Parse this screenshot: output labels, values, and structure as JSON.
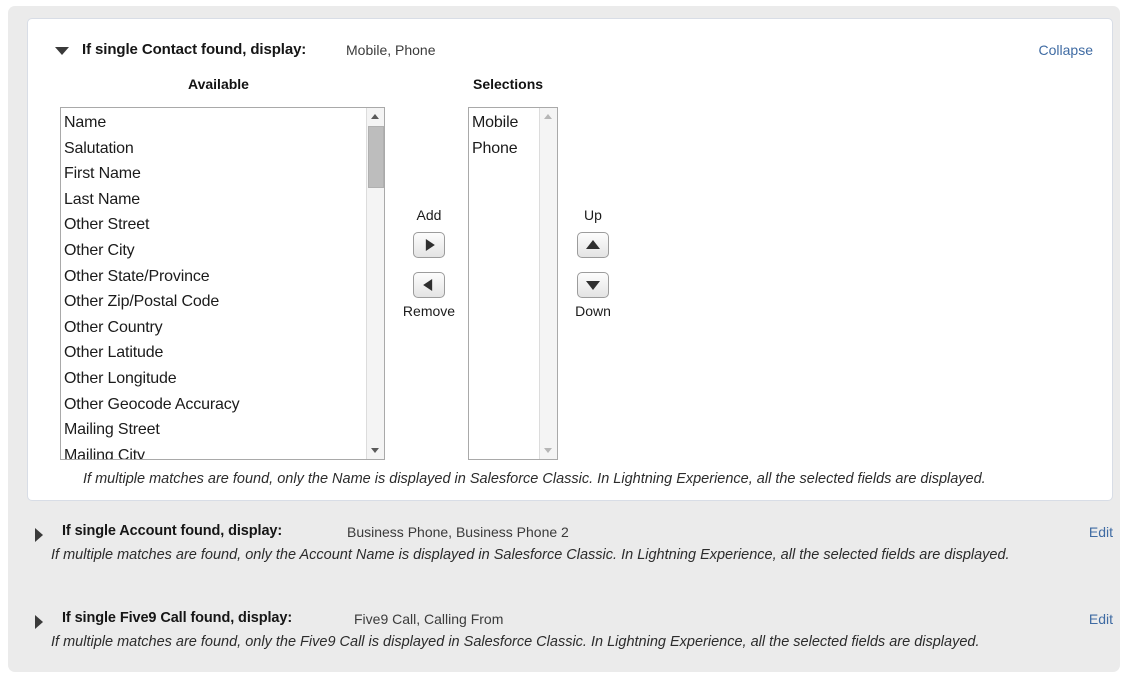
{
  "expanded_section": {
    "toggle_icon": "caret-down-icon",
    "label": "If single Contact found, display:",
    "value": "Mobile, Phone",
    "collapse_label": "Collapse",
    "available_title": "Available",
    "selections_title": "Selections",
    "available_options": [
      "Name",
      "Salutation",
      "First Name",
      "Last Name",
      "Other Street",
      "Other City",
      "Other State/Province",
      "Other Zip/Postal Code",
      "Other Country",
      "Other Latitude",
      "Other Longitude",
      "Other Geocode Accuracy",
      "Mailing Street",
      "Mailing City"
    ],
    "selected_options": [
      "Mobile",
      "Phone"
    ],
    "transfer_buttons": {
      "add_label": "Add",
      "add_icon": "caret-right-icon",
      "remove_label": "Remove",
      "remove_icon": "caret-left-icon"
    },
    "order_buttons": {
      "up_label": "Up",
      "up_icon": "caret-up-icon",
      "down_label": "Down",
      "down_icon": "caret-down-icon"
    },
    "helper_text": "If multiple matches are found, only the Name is displayed in Salesforce Classic. In Lightning Experience, all the selected fields are displayed."
  },
  "collapsed_sections": [
    {
      "toggle_icon": "caret-right-icon",
      "label": "If single Account found, display:",
      "value": "Business Phone, Business Phone 2",
      "edit_label": "Edit",
      "helper_text": "If multiple matches are found, only the Account Name is displayed in Salesforce Classic. In Lightning Experience, all the selected fields are displayed."
    },
    {
      "toggle_icon": "caret-right-icon",
      "label": "If single Five9 Call found, display:",
      "value": "Five9 Call, Calling From",
      "edit_label": "Edit",
      "helper_text": "If multiple matches are found, only the Five9 Call is displayed in Salesforce Classic. In Lightning Experience, all the selected fields are displayed."
    }
  ],
  "colors": {
    "link": "#3f6ba3",
    "shell_bg": "#ebebeb",
    "card_bg": "#ffffff",
    "listbox_border": "#a9a9a9",
    "scroll_thumb": "#bdbdbd"
  }
}
